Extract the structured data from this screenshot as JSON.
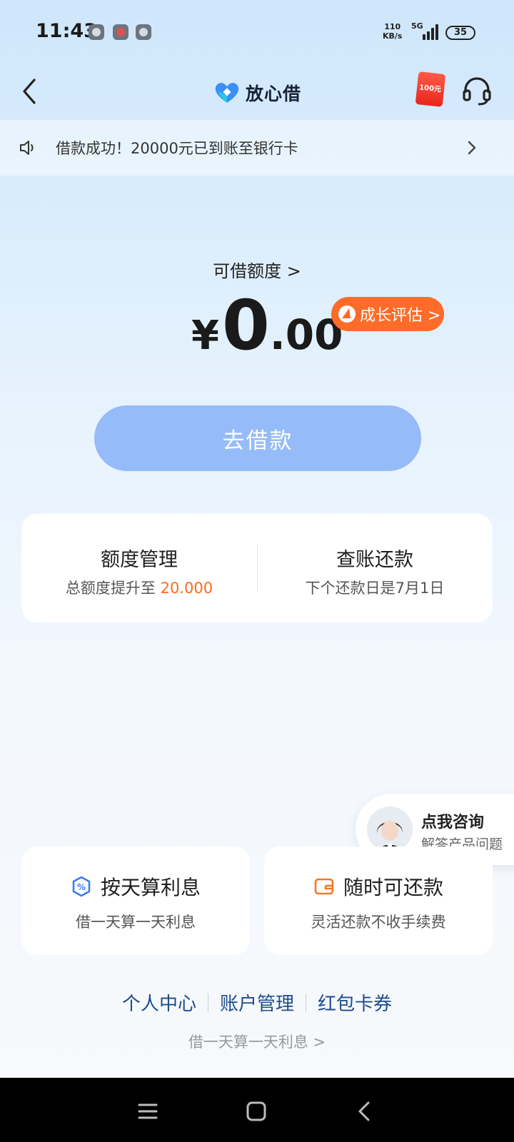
{
  "status_bar": {
    "time": "11:43",
    "net_speed_value": "110",
    "net_speed_unit": "KB/s",
    "network": "5G",
    "battery": "35"
  },
  "nav": {
    "app_name": "放心借",
    "red_packet_label": "100元"
  },
  "notice": {
    "text": "借款成功！20000元已到账至银行卡"
  },
  "credit": {
    "label": "可借额度 >",
    "currency": "¥",
    "amount_int": "0",
    "amount_dec": ".00",
    "growth_button": "成长评估 >"
  },
  "borrow_button": "去借款",
  "quota_card": {
    "left_title": "额度管理",
    "left_sub_prefix": "总额度提升至 ",
    "left_sub_value": "20.000",
    "right_title": "查账还款",
    "right_sub": "下个还款日是7月1日"
  },
  "consult": {
    "title": "点我咨询",
    "subtitle": "解答产品问题"
  },
  "features": [
    {
      "icon": "percent-shield-icon",
      "title": "按天算利息",
      "subtitle": "借一天算一天利息"
    },
    {
      "icon": "wallet-icon",
      "title": "随时可还款",
      "subtitle": "灵活还款不收手续费"
    }
  ],
  "links": [
    "个人中心",
    "账户管理",
    "红包卡券"
  ],
  "footer_tip": "借一天算一天利息 >",
  "colors": {
    "accent_orange": "#ff6b28",
    "primary_blue_disabled": "#95bbf8",
    "link_blue": "#1c4c8c"
  }
}
